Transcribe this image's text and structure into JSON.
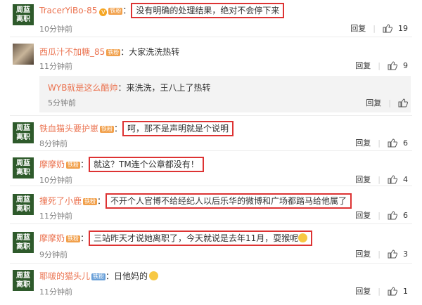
{
  "avatar_text": "周蓝\n离职",
  "labels": {
    "reply": "回复",
    "sep": "|",
    "colon": "："
  },
  "comments": [
    {
      "nick": "TracerYiBo-85",
      "badge": "铁粉",
      "vbadge": "V",
      "text": "没有明确的处理结果，绝对不会停下来",
      "time": "10分钟前",
      "likes": "19"
    },
    {
      "nick": "西瓜汁不加糖_85",
      "badge": "铁粉",
      "text": "大家洗洗热转",
      "time": "11分钟前",
      "likes": "9",
      "reply": {
        "nick": "WYB就是这么酷帅",
        "text": "来洗洗，王八上了热转",
        "time": "5分钟前"
      }
    },
    {
      "nick": "铁血猫头要护崽",
      "badge": "铁粉",
      "text": "呵，那不是声明就是个说明",
      "time": "8分钟前",
      "likes": "6"
    },
    {
      "nick": "摩摩奶",
      "badge": "铁粉",
      "text": "就这？TM连个公章都没有！",
      "time": "10分钟前",
      "likes": "4"
    },
    {
      "nick": "撞死了小鹿",
      "badge": "铁粉",
      "text": "不开个人官博不给经纪人以后乐华的微博和广场都踏马给他属了",
      "time": "11分钟前",
      "likes": "6"
    },
    {
      "nick": "摩摩奶",
      "badge": "铁粉",
      "text": "三站昨天才说她离职了，今天就说是去年11月，耍猴呢",
      "time": "9分钟前",
      "likes": "3"
    },
    {
      "nick": "耶啵的猫头儿",
      "badge": "铁粉",
      "text": "日他妈的",
      "time": "11分钟前",
      "likes": "1"
    }
  ],
  "colors": {
    "nick": "#eb7350",
    "highlight_border": "#dd3333",
    "avatar_bg": "#2e5a2b"
  }
}
